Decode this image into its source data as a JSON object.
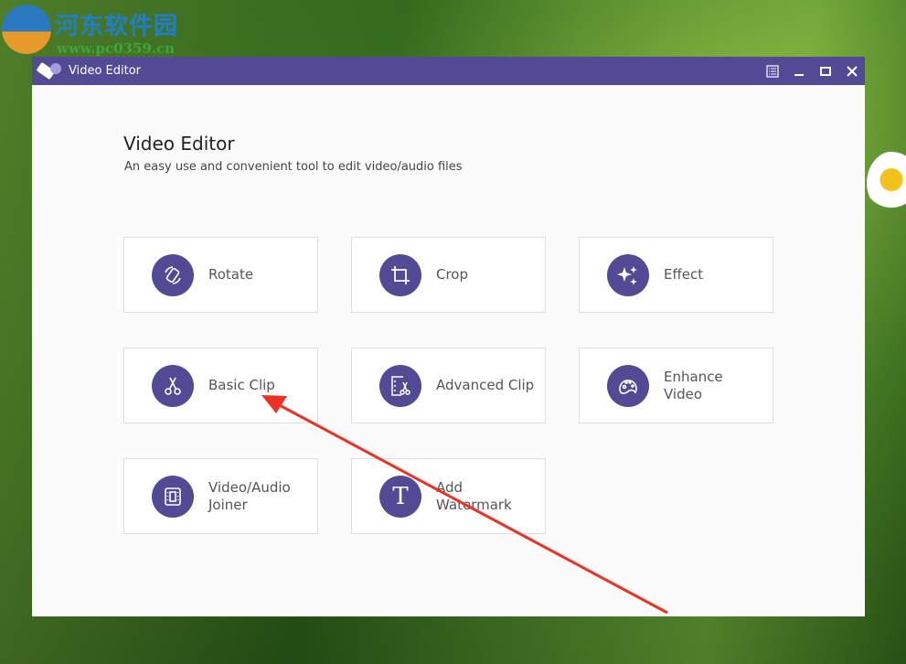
{
  "watermark": {
    "name": "河东软件园",
    "url": "www.pc0359.cn"
  },
  "window": {
    "title": "Video Editor",
    "controls": [
      "menu",
      "minimize",
      "maximize",
      "close"
    ]
  },
  "main": {
    "title": "Video Editor",
    "subtitle": "An easy use and convenient tool to edit video/audio files",
    "tools": [
      {
        "label": "Rotate",
        "icon": "rotate-icon"
      },
      {
        "label": "Crop",
        "icon": "crop-icon"
      },
      {
        "label": "Effect",
        "icon": "sparkle-icon"
      },
      {
        "label": "Basic Clip",
        "icon": "scissors-icon"
      },
      {
        "label": "Advanced Clip",
        "icon": "advanced-clip-icon"
      },
      {
        "label": "Enhance\nVideo",
        "icon": "palette-icon"
      },
      {
        "label": "Video/Audio\nJoiner",
        "icon": "joiner-icon"
      },
      {
        "label": "Add\nWatermark",
        "icon": "text-icon"
      }
    ]
  },
  "colors": {
    "accent": "#524a94",
    "annotation_arrow": "#f03024"
  }
}
